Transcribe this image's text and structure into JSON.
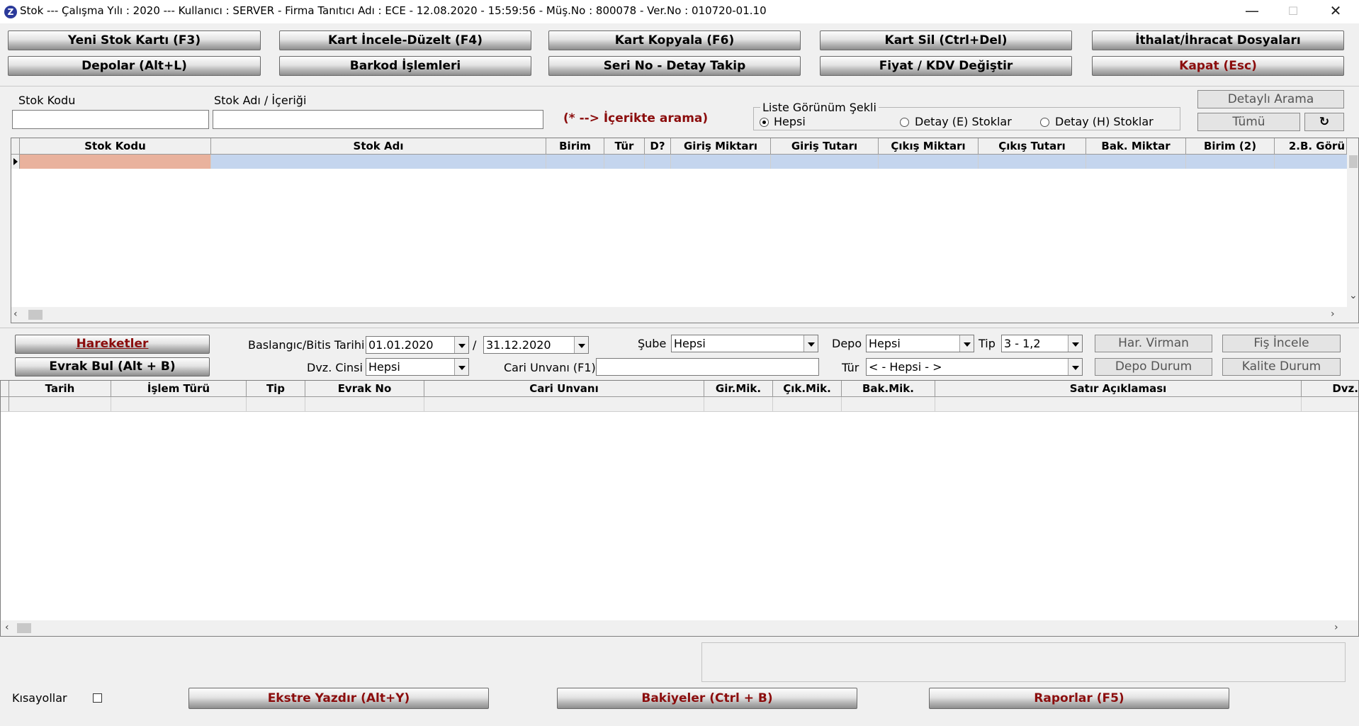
{
  "window": {
    "icon": "Z",
    "title": "Stok  ---  Çalışma Yılı : 2020  ---  Kullanıcı : SERVER - Firma Tanıtıcı Adı : ECE - 12.08.2020 - 15:59:56 - Müş.No : 800078 - Ver.No : 010720-01.10",
    "minimize": "—",
    "maximize": "☐",
    "close": "✕"
  },
  "toolbar": {
    "row1": [
      "Yeni Stok Kartı (F3)",
      "Kart İncele-Düzelt (F4)",
      "Kart Kopyala (F6)",
      "Kart Sil (Ctrl+Del)",
      "İthalat/İhracat Dosyaları"
    ],
    "row2": [
      "Depolar (Alt+L)",
      "Barkod İşlemleri",
      "Seri No - Detay Takip",
      "Fiyat / KDV Değiştir",
      "Kapat (Esc)"
    ]
  },
  "search": {
    "stok_kodu_label": "Stok Kodu",
    "stok_adi_label": "Stok Adı / İçeriği",
    "hint": "(* --> İçerikte arama)",
    "stok_kodu_value": "",
    "stok_adi_value": ""
  },
  "view": {
    "group_label": "Liste Görünüm Şekli",
    "options": [
      "Hepsi",
      "Detay (E) Stoklar",
      "Detay (H) Stoklar"
    ],
    "selected": "Hepsi"
  },
  "right_buttons": {
    "detayli": "Detaylı Arama",
    "tumu": "Tümü",
    "refresh": "↻"
  },
  "stock_grid": {
    "columns": [
      "Stok Kodu",
      "Stok Adı",
      "Birim",
      "Tür",
      "D?",
      "Giriş Miktarı",
      "Giriş Tutarı",
      "Çıkış Miktarı",
      "Çıkış Tutarı",
      "Bak. Miktar",
      "Birim (2)",
      "2.B. Görü"
    ]
  },
  "filters": {
    "hareketler": "Hareketler",
    "evrak_bul": "Evrak Bul (Alt + B)",
    "tarih_label": "Baslangıc/Bitis Tarihi",
    "start_date": "01.01.2020",
    "slash": "/",
    "end_date": "31.12.2020",
    "sube_label": "Şube",
    "sube_value": "Hepsi",
    "depo_label": "Depo",
    "depo_value": "Hepsi",
    "tip_label": "Tip",
    "tip_value": "3 - 1,2",
    "dvz_label": "Dvz. Cinsi",
    "dvz_value": "Hepsi",
    "cari_label": "Cari Unvanı (F1)",
    "cari_value": "",
    "tur_label": "Tür",
    "tur_value": "< - Hepsi - >",
    "har_virman": "Har. Virman",
    "fis_incele": "Fiş İncele",
    "depo_durum": "Depo Durum",
    "kalite_durum": "Kalite Durum"
  },
  "movement_grid": {
    "columns": [
      "Tarih",
      "İşlem Türü",
      "Tip",
      "Evrak No",
      "Cari Unvanı",
      "Gir.Mik.",
      "Çık.Mik.",
      "Bak.Mik.",
      "Satır Açıklaması",
      "Dvz."
    ]
  },
  "footer": {
    "kisayollar": "Kısayollar",
    "ekstre": "Ekstre Yazdır (Alt+Y)",
    "bakiyeler": "Bakiyeler (Ctrl + B)",
    "raporlar": "Raporlar (F5)"
  },
  "colors": {
    "accent_red": "#8b0d0d",
    "selected_row": "#c4d5ee",
    "selected_cell": "#e9b29d"
  }
}
